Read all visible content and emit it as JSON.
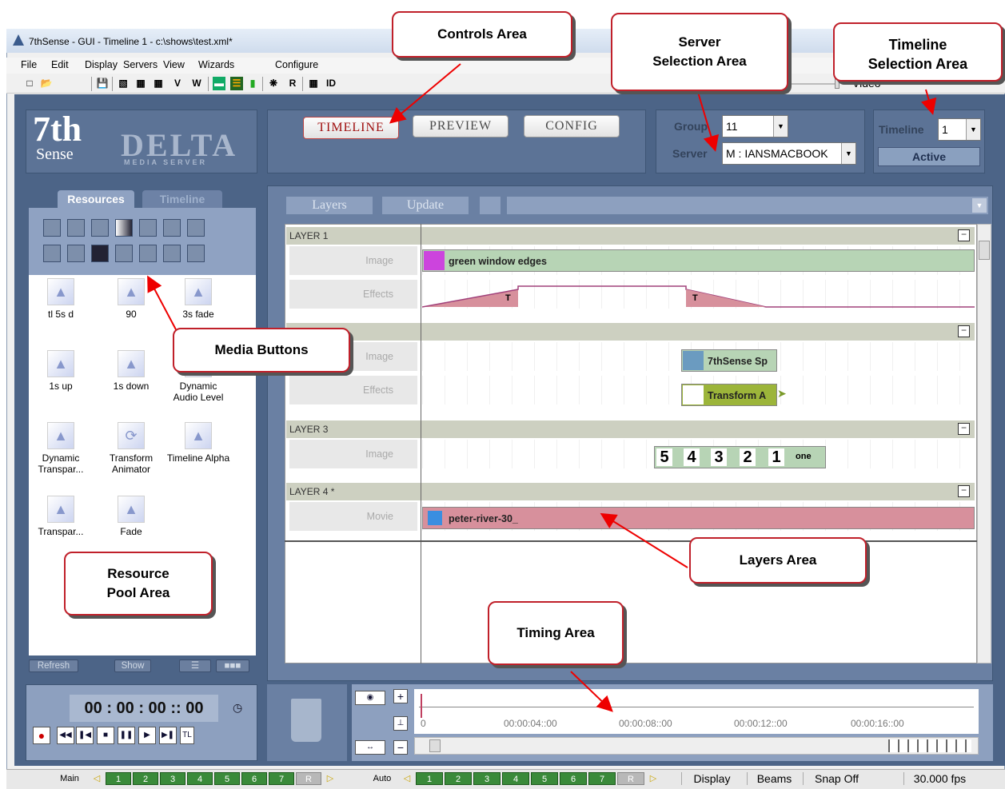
{
  "window": {
    "title": "7thSense - GUI - Timeline 1 - c:\\shows\\test.xml*"
  },
  "menu": [
    "File",
    "Edit",
    "Display",
    "Servers",
    "View",
    "Wizards",
    "Configure"
  ],
  "toolbar": {
    "v": "V",
    "w": "W",
    "r": "R",
    "id": "ID",
    "video": "Video"
  },
  "logo": {
    "brand": "7th",
    "brand2": "Sense",
    "product": "DELTA",
    "product_sub": "MEDIA SERVER"
  },
  "controls": {
    "tabs": [
      "TIMELINE",
      "PREVIEW",
      "CONFIG"
    ],
    "active": "TIMELINE"
  },
  "server": {
    "group_label": "Group",
    "group_value": "11",
    "server_label": "Server",
    "server_value": "M : IANSMACBOOK"
  },
  "timeline_sel": {
    "label": "Timeline",
    "value": "1",
    "status": "Active"
  },
  "resources": {
    "tabs": [
      "Resources",
      "Timeline"
    ],
    "items": [
      {
        "label": "tl 5s d"
      },
      {
        "label": "90"
      },
      {
        "label": "3s fade"
      },
      {
        "label": "1s up"
      },
      {
        "label": "1s down"
      },
      {
        "label": "Dynamic Audio Level"
      },
      {
        "label": "Dynamic Transpar..."
      },
      {
        "label": "Transform Animator"
      },
      {
        "label": "Timeline Alpha"
      },
      {
        "label": "Transpar..."
      },
      {
        "label": "Fade"
      }
    ],
    "buttons": {
      "refresh": "Refresh",
      "show": "Show"
    }
  },
  "layers": {
    "toolbar": {
      "layers": "Layers",
      "update": "Update"
    },
    "list": [
      {
        "name": "LAYER 1",
        "rows": [
          "Image",
          "Effects"
        ]
      },
      {
        "name": "",
        "rows": [
          "Image",
          "Effects"
        ]
      },
      {
        "name": "LAYER 3",
        "rows": [
          "Image"
        ]
      },
      {
        "name": "LAYER 4 *",
        "rows": [
          "Movie"
        ]
      }
    ],
    "clips": {
      "green": "green window edges",
      "t1": "T",
      "t2": "T",
      "sense": "7thSense Sp",
      "transform": "Transform A",
      "countdown": [
        "5",
        "4",
        "3",
        "2",
        "1",
        "one"
      ],
      "movie": "peter-river-30_"
    }
  },
  "transport": {
    "time": "00 : 00 : 00 :: 00"
  },
  "timing": {
    "ticks": [
      "0",
      "00:00:04::00",
      "00:00:08::00",
      "00:00:12::00",
      "00:00:16::00"
    ]
  },
  "statusbar": {
    "main": "Main",
    "auto": "Auto",
    "groups": [
      "1",
      "2",
      "3",
      "4",
      "5",
      "6",
      "7",
      "R"
    ],
    "display": "Display",
    "beams": "Beams",
    "snap": "Snap Off",
    "fps": "30.000 fps"
  },
  "callouts": {
    "controls": "Controls Area",
    "server": [
      "Server",
      "Selection Area"
    ],
    "timeline": [
      "Timeline",
      "Selection Area"
    ],
    "media": "Media Buttons",
    "resource": [
      "Resource",
      "Pool Area"
    ],
    "layers": "Layers Area",
    "timing": "Timing Area"
  },
  "colors": {
    "accent_red": "#c0202a",
    "panel_blue": "#5c7396",
    "clip_green": "#b7d4b5",
    "clip_pink": "#d7909c"
  }
}
